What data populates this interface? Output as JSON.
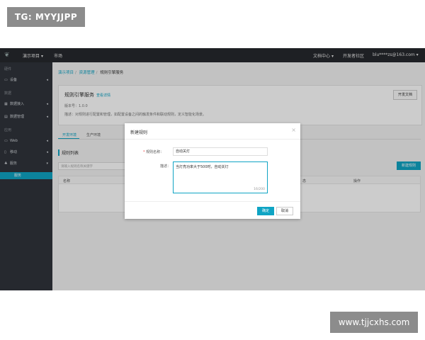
{
  "watermark_top": "TG: MYYJJPP",
  "watermark_bottom": "www.tjjcxhs.com",
  "topbar": {
    "project_menu": "演示项目",
    "market": "市场",
    "docs_menu": "文档中心",
    "community": "开发者社区",
    "user": "blu****zs@163.com"
  },
  "sidebar": {
    "sections": [
      {
        "title": "硬件",
        "items": [
          {
            "label": "设备",
            "icon": "device-icon"
          }
        ]
      },
      {
        "title": "数据",
        "items": [
          {
            "label": "数据接入",
            "icon": "data-in-icon"
          },
          {
            "label": "数据管理",
            "icon": "data-manage-icon"
          }
        ]
      },
      {
        "title": "应用",
        "items": [
          {
            "label": "Web",
            "icon": "web-icon"
          },
          {
            "label": "移动",
            "icon": "mobile-icon"
          },
          {
            "label": "服务",
            "icon": "service-icon"
          }
        ]
      }
    ],
    "active_item": "服务"
  },
  "breadcrumb": {
    "items": [
      "演示项目",
      "资源管理",
      "规则引擎服务"
    ]
  },
  "service_card": {
    "title": "规则引擎服务",
    "doc_link": "查看详情",
    "version": "版本号：1.0.0",
    "desc": "描述：对规则进行配置和管理，如配置设备之间的触发条件和联动规则，定义智能化场景。",
    "dev_doc_button": "开发文档"
  },
  "tabs": [
    "开发环境",
    "生产环境"
  ],
  "rule_list": {
    "title": "规则列表",
    "search_placeholder": "请输入规则名称关键字",
    "new_rule_button": "新建规则",
    "columns": [
      "名称",
      "态",
      "操作"
    ]
  },
  "modal": {
    "title": "新建规则",
    "name_label": "规则名称：",
    "name_value": "自动关灯",
    "desc_label": "描述：",
    "desc_value": "当灯亮功率大于500时，自动关灯",
    "counter": "16/200",
    "ok_label": "确定",
    "cancel_label": "取消"
  }
}
